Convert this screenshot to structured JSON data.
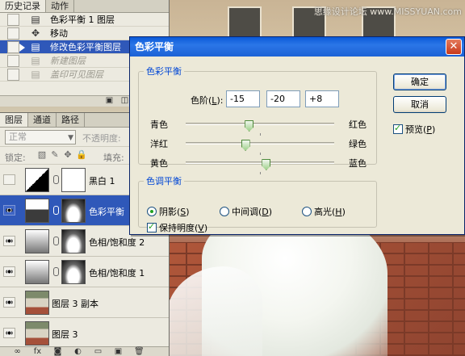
{
  "watermark": "思缘设计论坛  www.MISSYUAN.com",
  "history_panel": {
    "tabs": [
      "历史记录",
      "动作"
    ],
    "items": [
      {
        "label": "色彩平衡 1 图层",
        "icon": "document-icon",
        "state": "normal"
      },
      {
        "label": "移动",
        "icon": "move-icon",
        "state": "normal"
      },
      {
        "label": "修改色彩平衡图层",
        "icon": "document-icon",
        "state": "selected"
      },
      {
        "label": "新建图层",
        "icon": "document-icon",
        "state": "grayed"
      },
      {
        "label": "盖印可见图层",
        "icon": "document-icon",
        "state": "grayed"
      }
    ]
  },
  "layers_panel": {
    "tabs": [
      "图层",
      "通道",
      "路径"
    ],
    "blend_mode": "正常",
    "opacity_label": "不透明度:",
    "lock_label": "锁定:",
    "fill_label": "填充:",
    "layers": [
      {
        "name": "黑白 1",
        "visible": false,
        "type": "adjustment-bw"
      },
      {
        "name": "色彩平衡",
        "visible": true,
        "type": "adjustment-color",
        "active": true
      },
      {
        "name": "色相/饱和度 2",
        "visible": true,
        "type": "adjustment-hue"
      },
      {
        "name": "色相/饱和度 1",
        "visible": true,
        "type": "adjustment-hue"
      },
      {
        "name": "图层 3 副本",
        "visible": true,
        "type": "image"
      },
      {
        "name": "图层 3",
        "visible": true,
        "type": "image"
      }
    ]
  },
  "dialog": {
    "title": "色彩平衡",
    "balance_group": "色彩平衡",
    "levels_label": "色阶(",
    "levels_key": "L",
    "levels_tail": "):",
    "levels": [
      "-15",
      "-20",
      "+8"
    ],
    "sliders": [
      {
        "left": "青色",
        "right": "红色",
        "value": -15
      },
      {
        "left": "洋红",
        "right": "绿色",
        "value": -20
      },
      {
        "left": "黄色",
        "right": "蓝色",
        "value": 8
      }
    ],
    "tone_group": "色调平衡",
    "tones": [
      {
        "label": "阴影(",
        "key": "S",
        "tail": ")",
        "checked": true
      },
      {
        "label": "中间调(",
        "key": "D",
        "tail": ")",
        "checked": false
      },
      {
        "label": "高光(",
        "key": "H",
        "tail": ")",
        "checked": false
      }
    ],
    "preserve_luminosity": {
      "label": "保持明度(",
      "key": "V",
      "tail": ")",
      "checked": true
    },
    "ok_label": "确定",
    "cancel_label": "取消",
    "preview": {
      "label": "预览(",
      "key": "P",
      "tail": ")",
      "checked": true
    }
  },
  "colors": {
    "selection": "#2f58b9",
    "titlebar": "#0a5ad8",
    "group_label": "#0046d5"
  }
}
